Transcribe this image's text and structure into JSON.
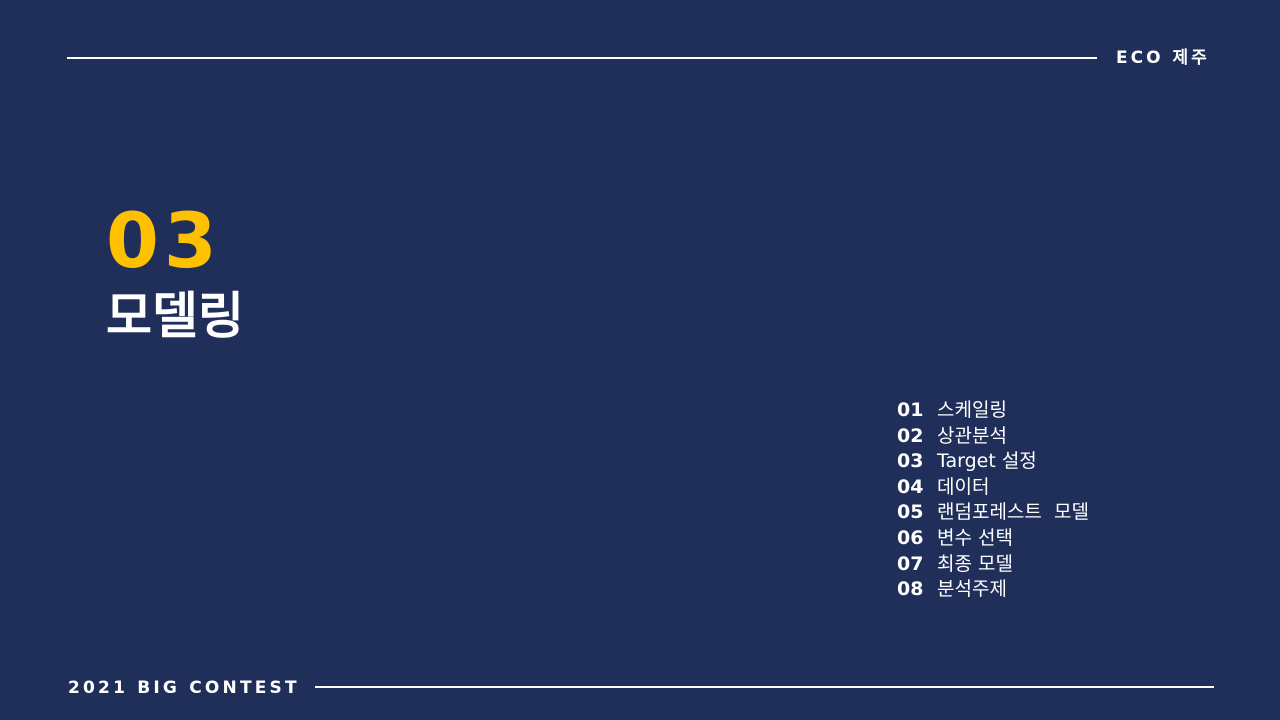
{
  "header": {
    "brand": "ECO 제주"
  },
  "section": {
    "number": "03",
    "title": "모델링"
  },
  "toc": {
    "items": [
      {
        "num": "01",
        "label": "스케일링"
      },
      {
        "num": "02",
        "label": "상관분석"
      },
      {
        "num": "03",
        "label": "Target 설정"
      },
      {
        "num": "04",
        "label": "데이터"
      },
      {
        "num": "05",
        "label": "랜덤포레스트  모델"
      },
      {
        "num": "06",
        "label": "변수 선택"
      },
      {
        "num": "07",
        "label": "최종 모델"
      },
      {
        "num": "08",
        "label": "분석주제"
      }
    ]
  },
  "footer": {
    "brand": "2021 BIG CONTEST"
  },
  "colors": {
    "background": "#1f2f5a",
    "accent": "#ffc000",
    "text": "#ffffff"
  }
}
